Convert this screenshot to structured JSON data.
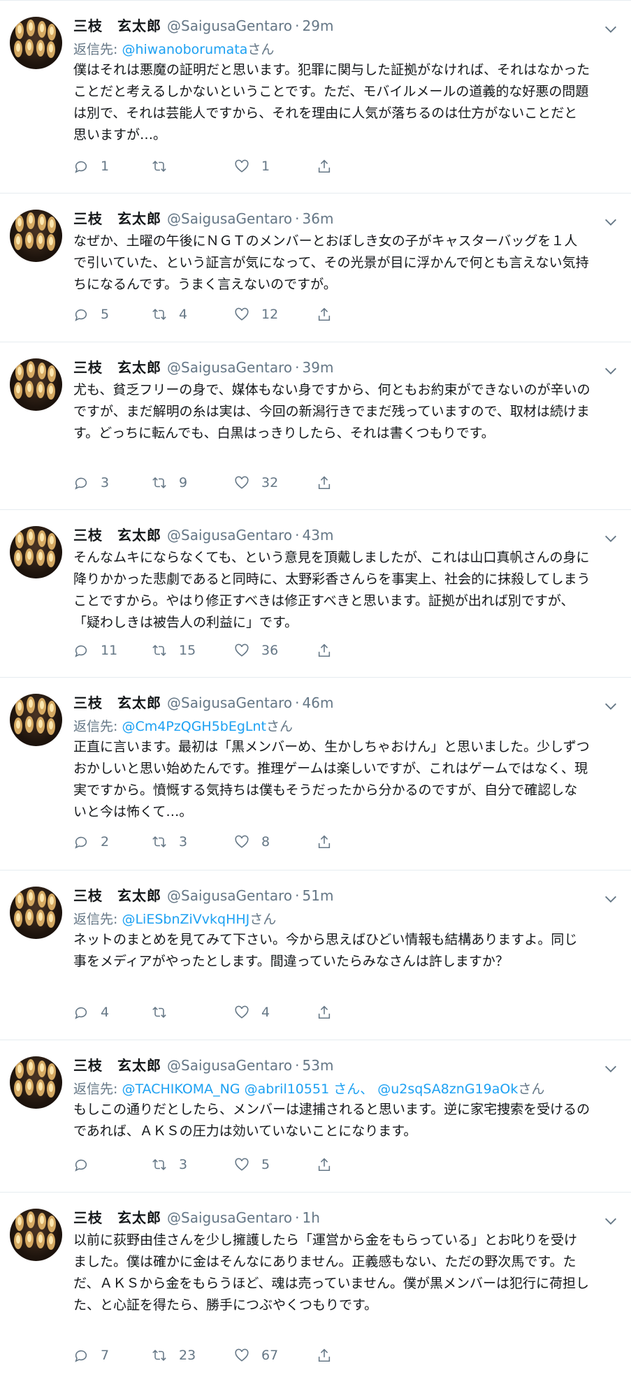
{
  "account": {
    "name": "三枝　玄太郎",
    "handle": "@SaigusaGentaro",
    "separator": "·"
  },
  "reply_prefix": "返信先:",
  "tweets": [
    {
      "time": "29m",
      "reply_mentions": "@hiwanoborumata",
      "reply_suffix": "さん",
      "text": "僕はそれは悪魔の証明だと思います。犯罪に関与した証拠がなければ、それはなかったことだと考えるしかないということです。ただ、モバイルメールの道義的な好悪の問題は別で、それは芸能人ですから、それを理由に人気が落ちるのは仕方がないことだと思いますが…。",
      "replies": "1",
      "retweets": "",
      "likes": "1"
    },
    {
      "time": "36m",
      "text": "なぜか、土曜の午後にＮＧＴのメンバーとおぼしき女の子がキャスターバッグを１人で引いていた、という証言が気になって、その光景が目に浮かんで何とも言えない気持ちになるんです。うまく言えないのですが。",
      "replies": "5",
      "retweets": "4",
      "likes": "12"
    },
    {
      "time": "39m",
      "text": "尤も、貧乏フリーの身で、媒体もない身ですから、何ともお約束ができないのが辛いのですが、まだ解明の糸は実は、今回の新潟行きでまだ残っていますので、取材は続けます。どっちに転んでも、白黒はっきりしたら、それは書くつもりです。",
      "replies": "3",
      "retweets": "9",
      "likes": "32"
    },
    {
      "time": "43m",
      "text": "そんなムキにならなくても、という意見を頂戴しましたが、これは山口真帆さんの身に降りかかった悲劇であると同時に、太野彩香さんらを事実上、社会的に抹殺してしまうことですから。やはり修正すべきは修正すべきと思います。証拠が出れば別ですが、「疑わしきは被告人の利益に」です。",
      "replies": "11",
      "retweets": "15",
      "likes": "36"
    },
    {
      "time": "46m",
      "reply_mentions": "@Cm4PzQGH5bEgLnt",
      "reply_suffix": "さん",
      "text": "正直に言います。最初は「黒メンバーめ、生かしちゃおけん」と思いました。少しずつおかしいと思い始めたんです。推理ゲームは楽しいですが、これはゲームではなく、現実ですから。憤慨する気持ちは僕もそうだったから分かるのですが、自分で確認しないと今は怖くて…。",
      "replies": "2",
      "retweets": "3",
      "likes": "8"
    },
    {
      "time": "51m",
      "reply_mentions": "@LiESbnZiVvkqHHJ",
      "reply_suffix": "さん",
      "text": "ネットのまとめを見てみて下さい。今から思えばひどい情報も結構ありますよ。同じ事をメディアがやったとします。間違っていたらみなさんは許しますか？",
      "replies": "4",
      "retweets": "",
      "likes": "4"
    },
    {
      "time": "53m",
      "reply_mentions": "@TACHIKOMA_NG @abril10551 さん、 @u2sqSA8znG19aOk",
      "reply_suffix": "さん",
      "text": "もしこの通りだとしたら、メンバーは逮捕されると思います。逆に家宅捜索を受けるのであれば、ＡＫＳの圧力は効いていないことになります。",
      "replies": "",
      "retweets": "3",
      "likes": "5"
    },
    {
      "time": "1h",
      "text": "以前に荻野由佳さんを少し擁護したら「運営から金をもらっている」とお叱りを受けました。僕は確かに金はそんなにありません。正義感もない、ただの野次馬です。ただ、ＡＫＳから金をもらうほど、魂は売っていません。僕が黒メンバーは犯行に荷担した、と心証を得たら、勝手につぶやくつもりです。",
      "replies": "7",
      "retweets": "23",
      "likes": "67"
    }
  ],
  "icons": {
    "reply": "reply-icon",
    "retweet": "retweet-icon",
    "like": "heart-icon",
    "share": "share-icon",
    "menu": "chevron-down-icon",
    "avatar": "candle-lights-avatar"
  },
  "colors": {
    "text": "#14171a",
    "secondary": "#657786",
    "link": "#1da1f2",
    "divider": "#e6ecf0"
  }
}
